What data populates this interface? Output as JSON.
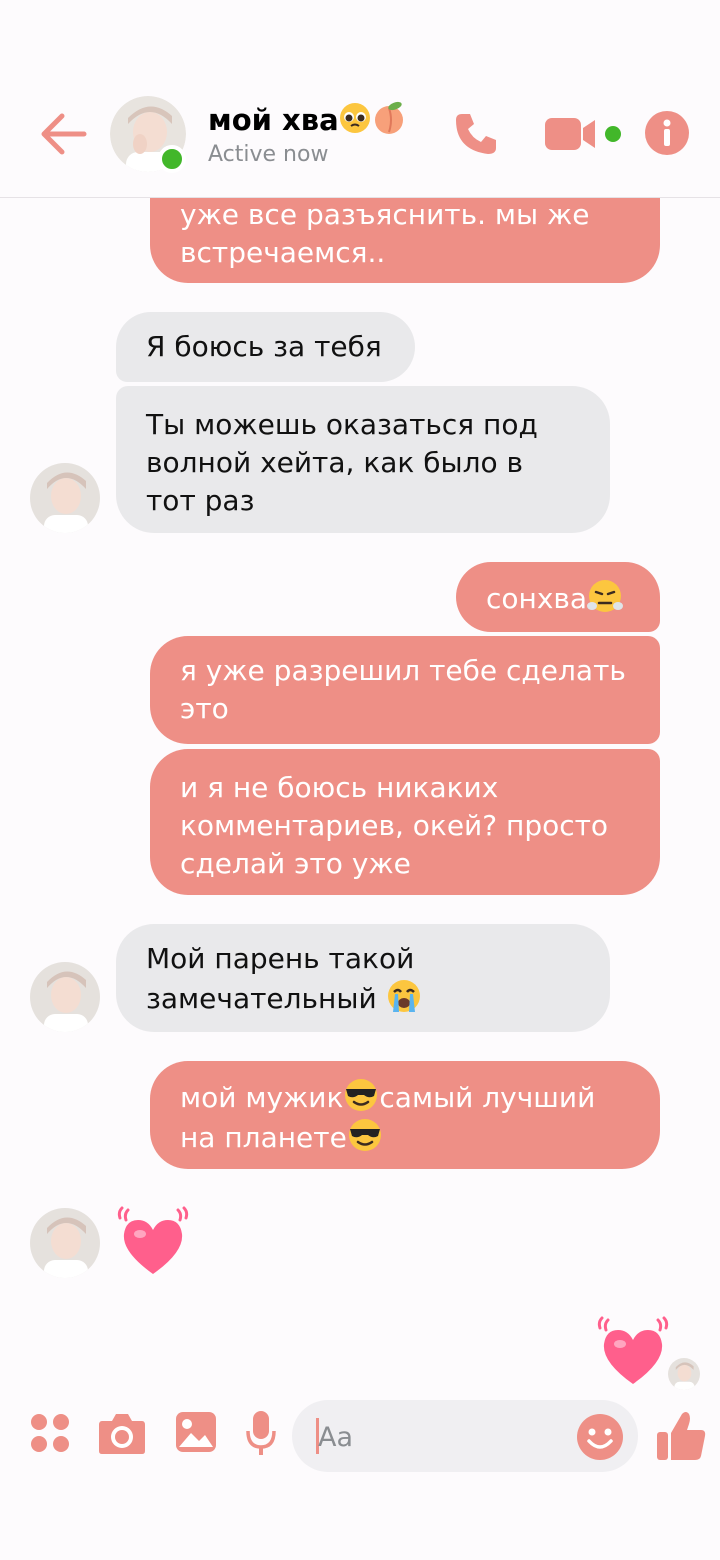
{
  "header": {
    "name": "мой хва",
    "name_emojis": [
      "pleading-face",
      "peach"
    ],
    "status": "Active now",
    "icons": [
      "back-arrow-icon",
      "phone-icon",
      "video-camera-icon",
      "info-icon"
    ]
  },
  "messages": [
    {
      "side": "out",
      "text": "уже все разъяснить. мы же встречаемся.."
    },
    {
      "side": "in",
      "text": "Я боюсь за тебя"
    },
    {
      "side": "in",
      "text": "Ты можешь оказаться под волной хейта, как было в тот раз"
    },
    {
      "side": "out",
      "text": "сонхва",
      "emoji": "huffing-face"
    },
    {
      "side": "out",
      "text": "я уже разрешил тебе сделать это"
    },
    {
      "side": "out",
      "text": "и я не боюсь никаких комментариев, окей? просто сделай это уже"
    },
    {
      "side": "in",
      "text": "Мой парень такой замечательный",
      "emoji": "loudly-crying-face"
    },
    {
      "side": "out",
      "text_parts": [
        "мой мужик",
        "самый лучший на планете"
      ],
      "emoji": "sunglasses-face"
    },
    {
      "side": "in",
      "emoji": "growing-heart"
    },
    {
      "side": "out",
      "emoji": "growing-heart"
    }
  ],
  "composer": {
    "placeholder": "Aa",
    "icons": [
      "menu-dots-icon",
      "camera-icon",
      "gallery-icon",
      "microphone-icon",
      "emoji-icon",
      "thumbs-up-icon"
    ]
  },
  "colors": {
    "accent": "#ee8f86",
    "incoming_bubble": "#e9e9eb",
    "online": "#42b72a"
  }
}
